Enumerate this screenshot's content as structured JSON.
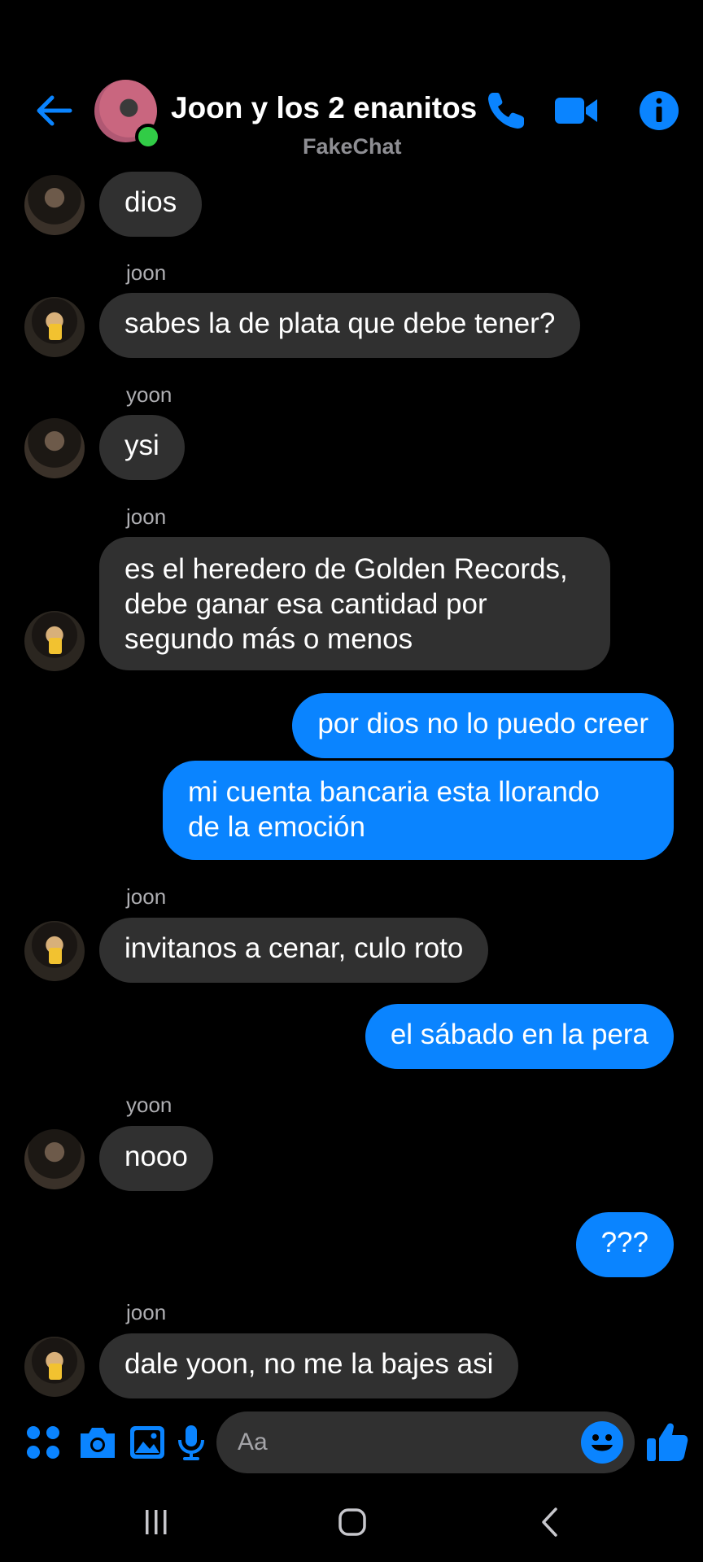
{
  "header": {
    "back_icon": "arrow-left-icon",
    "title": "Joon y los 2 enanitos",
    "subtitle": "FakeChat",
    "icons": [
      "phone-icon",
      "video-camera-icon",
      "info-icon"
    ],
    "accent_color": "#0a84ff",
    "online_color": "#31cc46"
  },
  "messages": [
    {
      "direction": "in",
      "sender": "",
      "text": "dios"
    },
    {
      "direction": "in",
      "sender": "joon",
      "text": "sabes la de plata que debe tener?"
    },
    {
      "direction": "in",
      "sender": "yoon",
      "text": "ysi"
    },
    {
      "direction": "in",
      "sender": "joon",
      "lines": [
        "es el heredero de Golden Records,",
        "debe ganar esa cantidad por",
        "segundo más o menos"
      ]
    },
    {
      "direction": "out",
      "text": "por dios no lo puedo creer"
    },
    {
      "direction": "out",
      "lines": [
        "mi cuenta bancaria esta llorando",
        "de la emoción"
      ]
    },
    {
      "direction": "in",
      "sender": "joon",
      "text": "invitanos a cenar, culo roto"
    },
    {
      "direction": "out",
      "text": "el sábado en la pera"
    },
    {
      "direction": "in",
      "sender": "yoon",
      "text": "nooo"
    },
    {
      "direction": "out",
      "text": "???"
    },
    {
      "direction": "in",
      "sender": "joon",
      "text": "dale yoon, no me la bajes asi"
    }
  ],
  "composer": {
    "placeholder": "Aa",
    "icons": [
      "apps-grid-icon",
      "camera-icon",
      "gallery-icon",
      "microphone-icon",
      "emoji-icon",
      "thumbs-up-icon"
    ]
  },
  "system_nav": {
    "icons": [
      "recent-apps-icon",
      "home-icon",
      "back-nav-icon"
    ]
  },
  "colors": {
    "background": "#000000",
    "incoming_bubble": "#303030",
    "outgoing_bubble": "#0a84ff",
    "sender_label": "#aeaeb2"
  }
}
